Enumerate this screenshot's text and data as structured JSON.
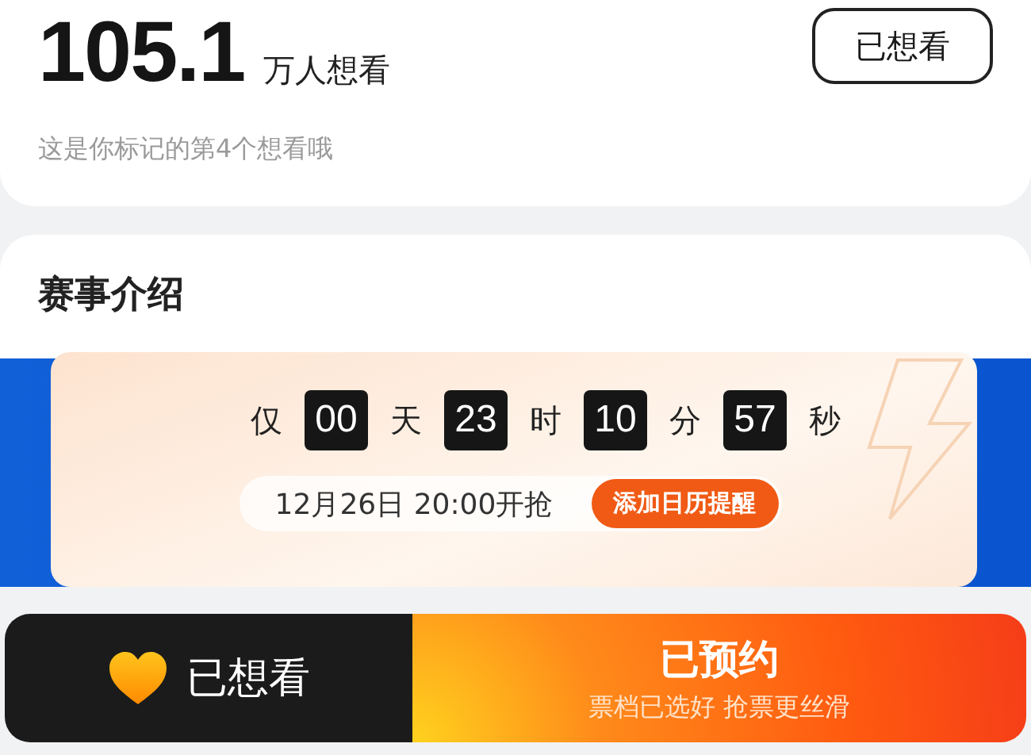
{
  "want": {
    "count": "105.1",
    "unit": "万人想看",
    "note": "这是你标记的第4个想看哦",
    "button": "已想看"
  },
  "section": {
    "title": "赛事介绍"
  },
  "countdown": {
    "prefix": "仅",
    "parts": [
      {
        "value": "00",
        "unit": "天"
      },
      {
        "value": "23",
        "unit": "时"
      },
      {
        "value": "10",
        "unit": "分"
      },
      {
        "value": "57",
        "unit": "秒"
      }
    ],
    "start": "12月26日 20:00开抢",
    "reminder": "添加日历提醒"
  },
  "bottom_bar": {
    "want_label": "已想看",
    "reserve_title": "已预约",
    "reserve_subtitle": "票档已选好 抢票更丝滑"
  }
}
